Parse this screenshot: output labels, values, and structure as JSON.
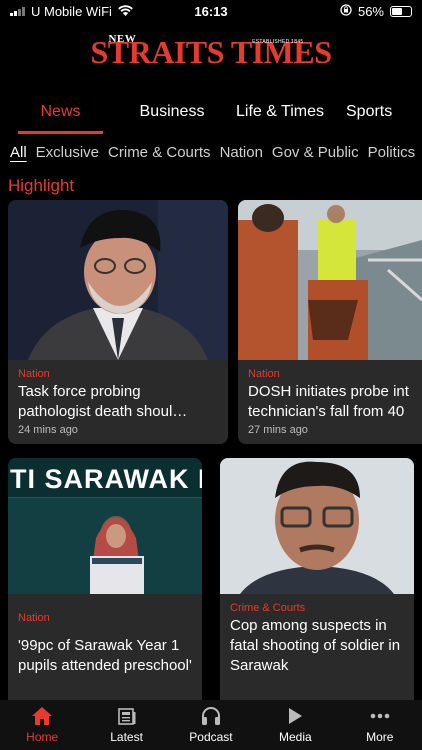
{
  "status_bar": {
    "carrier": "U Mobile WiFi",
    "time": "16:13",
    "battery": "56%",
    "battery_level": 0.56
  },
  "header": {
    "logo_new": "NEW",
    "logo_main": "STRAITS TIMES",
    "logo_est": "ESTABLISHED 1845",
    "brand_color": "#e63a2e"
  },
  "main_tabs": [
    {
      "label": "News",
      "active": true
    },
    {
      "label": "Business",
      "active": false
    },
    {
      "label": "Life & Times",
      "active": false
    },
    {
      "label": "Sports",
      "active": false
    }
  ],
  "sub_tabs": [
    {
      "label": "All",
      "active": true
    },
    {
      "label": "Exclusive",
      "active": false
    },
    {
      "label": "Crime & Courts",
      "active": false
    },
    {
      "label": "Nation",
      "active": false
    },
    {
      "label": "Gov & Public",
      "active": false
    },
    {
      "label": "Politics",
      "active": false
    }
  ],
  "section": {
    "title": "Highlight"
  },
  "cards": [
    {
      "category": "Nation",
      "title": "Task force probing pathologist death shoul…",
      "time": "24 mins ago",
      "image": "man-turban-photo"
    },
    {
      "category": "Nation",
      "title": "DOSH initiates probe int technician's fall from 40",
      "time": "27 mins ago",
      "image": "rescue-team-photo"
    },
    {
      "category": "Nation",
      "title": "'99pc of Sarawak Year 1 pupils attended preschool'",
      "time": "",
      "image": "sarawak-speaker-photo",
      "banner_text": "TI SARAWAK M"
    },
    {
      "category": "Crime & Courts",
      "title": "Cop among suspects in fatal shooting of soldier in Sarawak",
      "time": "",
      "image": "man-glasses-photo"
    }
  ],
  "bottom_nav": [
    {
      "label": "Home",
      "icon": "home-icon",
      "active": true
    },
    {
      "label": "Latest",
      "icon": "newspaper-icon",
      "active": false
    },
    {
      "label": "Podcast",
      "icon": "headphones-icon",
      "active": false
    },
    {
      "label": "Media",
      "icon": "play-icon",
      "active": false
    },
    {
      "label": "More",
      "icon": "more-dots-icon",
      "active": false
    }
  ]
}
